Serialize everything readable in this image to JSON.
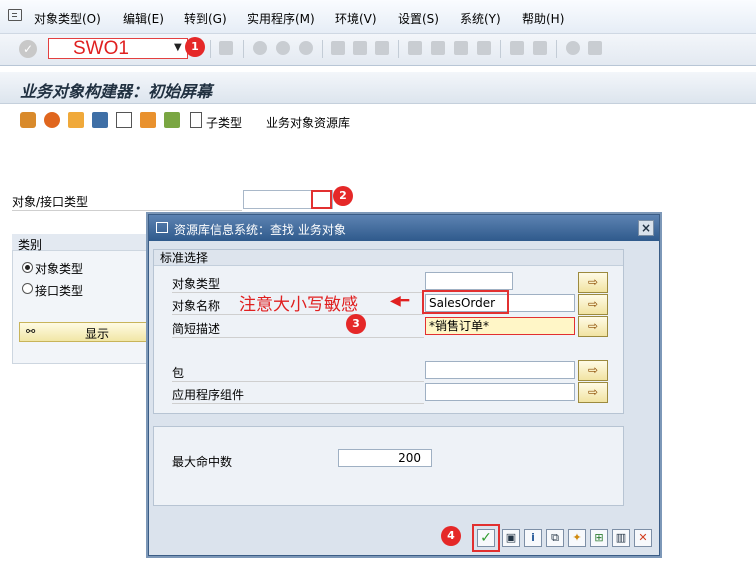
{
  "menubar": {
    "items": [
      "对象类型(O)",
      "编辑(E)",
      "转到(G)",
      "实用程序(M)",
      "环境(V)",
      "设置(S)",
      "系统(Y)",
      "帮助(H)"
    ]
  },
  "toolbar": {
    "tcode": "SWO1"
  },
  "badges": [
    "1",
    "2",
    "3",
    "4"
  ],
  "page": {
    "title": "业务对象构建器：初始屏幕",
    "app_toolbar": {
      "subtype_label": "子类型",
      "repository_label": "业务对象资源库"
    },
    "object_interface_type_label": "对象/接口类型",
    "category": {
      "title": "类别",
      "options": [
        {
          "label": "对象类型",
          "selected": true
        },
        {
          "label": "接口类型",
          "selected": false
        }
      ]
    },
    "display_button": "显示"
  },
  "dialog": {
    "title": "资源库信息系统：查找 业务对象",
    "section_title": "标准选择",
    "fields": [
      {
        "label": "对象类型",
        "value": ""
      },
      {
        "label": "对象名称",
        "value": "SalesOrder"
      },
      {
        "label": "简短描述",
        "value": "*销售订单*"
      },
      {
        "label": "包",
        "value": ""
      },
      {
        "label": "应用程序组件",
        "value": ""
      }
    ],
    "max_hits_label": "最大命中数",
    "max_hits_value": "200",
    "annotation": "注意大小写敏感"
  },
  "colors": {
    "annotation_red": "#e02020",
    "dialog_title_bg": "#2f5a8c",
    "confirm_green": "#2e9b2e"
  }
}
